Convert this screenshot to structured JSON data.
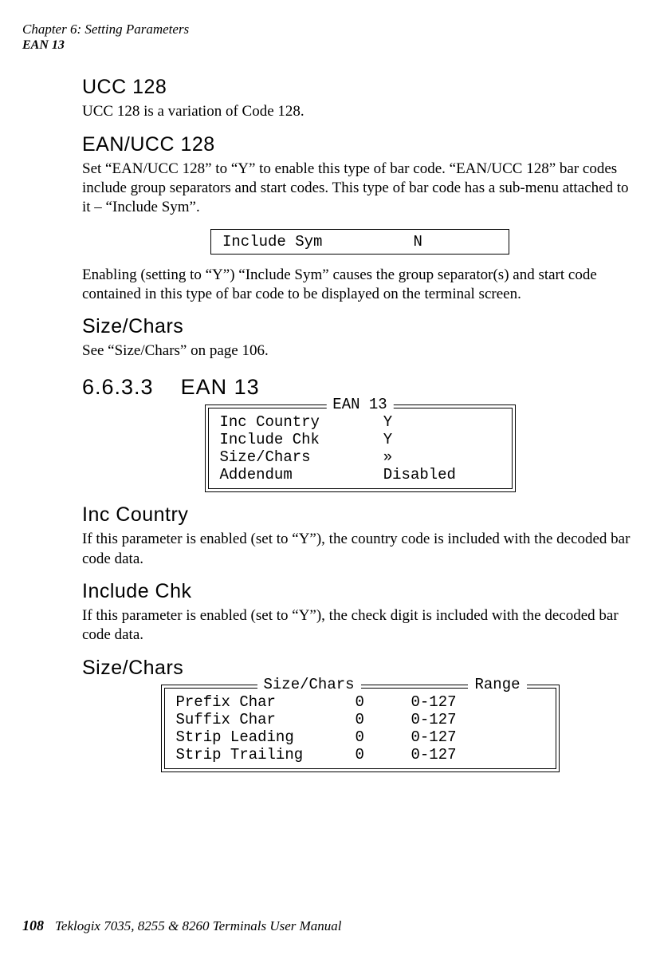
{
  "header": {
    "chapter_line": "Chapter  6:  Setting Parameters",
    "subline": "EAN 13"
  },
  "ucc128": {
    "title": "UCC  128",
    "body": "UCC 128 is a variation of Code 128."
  },
  "eanucc128": {
    "title": "EAN/UCC  128",
    "body1": "Set “EAN/UCC 128” to “Y” to enable this type of bar code. “EAN/UCC 128” bar codes include group separators and start codes. This type of bar code has a sub-menu attached to it – “Include Sym”.",
    "boxline": "Include Sym          N",
    "body2": "Enabling (setting to “Y”) “Include Sym” causes the group separator(s) and start code contained in this type of bar code to be displayed on the terminal screen."
  },
  "sizechars1": {
    "title": "Size/Chars",
    "body": "See “Size/Chars” on page 106."
  },
  "ean13": {
    "secnum": "6.6.3.3",
    "secname": "EAN  13",
    "legend": "EAN 13",
    "rows": [
      {
        "name": "Inc Country",
        "val": "Y"
      },
      {
        "name": "Include Chk",
        "val": "Y"
      },
      {
        "name": "Size/Chars",
        "val": "»"
      },
      {
        "name": "Addendum",
        "val": "Disabled"
      }
    ]
  },
  "inc_country": {
    "title": "Inc Country",
    "body": "If this parameter is enabled (set to “Y”), the country code is included with the decoded bar code data."
  },
  "include_chk": {
    "title": "Include Chk",
    "body": "If this parameter is enabled (set to “Y”), the check digit is included with the decoded bar code data."
  },
  "sizechars2": {
    "title": "Size/Chars",
    "legend_left": "Size/Chars",
    "legend_right": "Range",
    "rows": [
      {
        "name": "Prefix Char",
        "val": "0",
        "range": "0-127"
      },
      {
        "name": "Suffix Char",
        "val": "0",
        "range": "0-127"
      },
      {
        "name": "Strip Leading",
        "val": "0",
        "range": "0-127"
      },
      {
        "name": "Strip Trailing",
        "val": "0",
        "range": "0-127"
      }
    ]
  },
  "footer": {
    "pagenum": "108",
    "manual": "Teklogix 7035, 8255 & 8260 Terminals User Manual"
  }
}
